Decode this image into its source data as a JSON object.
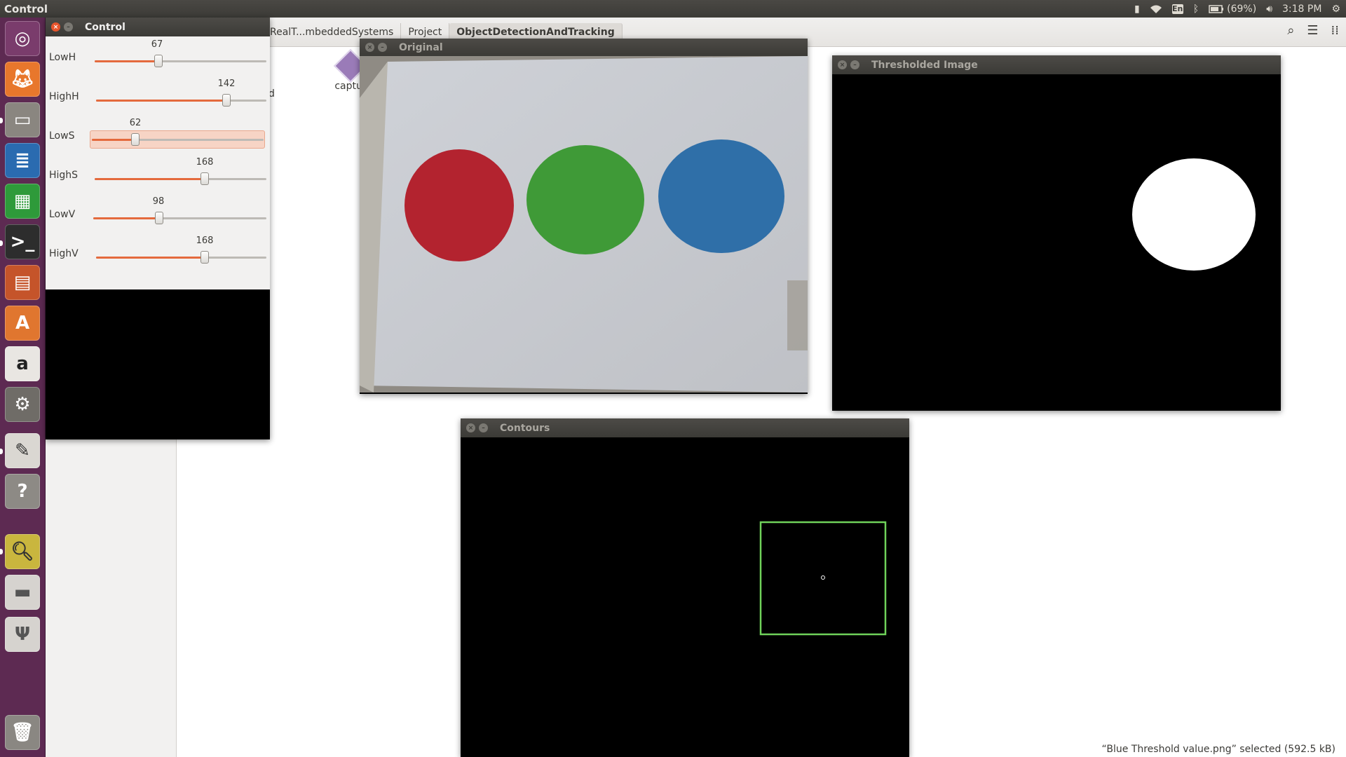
{
  "top_panel": {
    "app_title": "Control",
    "keyboard_layout": "En",
    "battery": "(69%)",
    "time": "3:18 PM"
  },
  "launcher": {
    "items": [
      "ubuntu-dash",
      "firefox",
      "files",
      "writer",
      "calc",
      "terminal",
      "impress",
      "software-center",
      "amazon",
      "system-settings",
      "text-editor",
      "help",
      "image-viewer",
      "disk",
      "usb-creator",
      "trash"
    ]
  },
  "file_manager": {
    "breadcrumbs": [
      "RealT...mbeddedSystems",
      "Project",
      "ObjectDetectionAndTracking"
    ],
    "file_label": "captur",
    "side_fragment": "d",
    "status": "“Blue Threshold value.png” selected  (592.5 kB)"
  },
  "control_window": {
    "title": "Control",
    "trackbars": [
      {
        "label": "LowH",
        "value": "67",
        "fraction": 0.37
      },
      {
        "label": "HighH",
        "value": "142",
        "fraction": 0.79
      },
      {
        "label": "LowS",
        "value": "62",
        "fraction": 0.35
      },
      {
        "label": "HighS",
        "value": "168",
        "fraction": 0.66
      },
      {
        "label": "LowV",
        "value": "98",
        "fraction": 0.38
      },
      {
        "label": "HighV",
        "value": "168",
        "fraction": 0.66
      }
    ]
  },
  "original_window": {
    "title": "Original"
  },
  "threshold_window": {
    "title": "Thresholded Image"
  },
  "contours_window": {
    "title": "Contours"
  },
  "colors": {
    "accent": "#e46a3d",
    "launcher": "#5d2a52",
    "circle_red": "#b3232f",
    "circle_green": "#3f9a37",
    "circle_blue": "#2f6fa8",
    "contour_box": "#6fd25a"
  }
}
